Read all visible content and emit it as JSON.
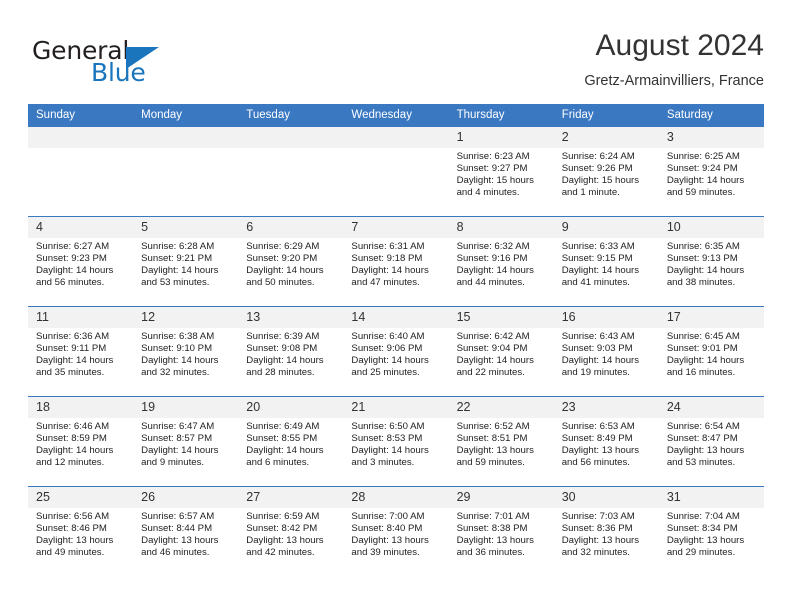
{
  "brand": {
    "name_part1": "General",
    "name_part2": "Blue",
    "accent_color": "#1b75bc"
  },
  "header": {
    "title": "August 2024",
    "subtitle": "Gretz-Armainvilliers, France"
  },
  "theme": {
    "header_row_color": "#3a78c2",
    "daynum_band_color": "#f2f2f2"
  },
  "labels": {
    "sunrise_prefix": "Sunrise:",
    "sunset_prefix": "Sunset:",
    "daylight_prefix": "Daylight:"
  },
  "weekdays": [
    "Sunday",
    "Monday",
    "Tuesday",
    "Wednesday",
    "Thursday",
    "Friday",
    "Saturday"
  ],
  "weeks": [
    [
      {
        "day": "",
        "empty": true
      },
      {
        "day": "",
        "empty": true
      },
      {
        "day": "",
        "empty": true
      },
      {
        "day": "",
        "empty": true
      },
      {
        "day": "1",
        "sunrise": "Sunrise: 6:23 AM",
        "sunset": "Sunset: 9:27 PM",
        "daylight_l1": "Daylight: 15 hours",
        "daylight_l2": "and 4 minutes."
      },
      {
        "day": "2",
        "sunrise": "Sunrise: 6:24 AM",
        "sunset": "Sunset: 9:26 PM",
        "daylight_l1": "Daylight: 15 hours",
        "daylight_l2": "and 1 minute."
      },
      {
        "day": "3",
        "sunrise": "Sunrise: 6:25 AM",
        "sunset": "Sunset: 9:24 PM",
        "daylight_l1": "Daylight: 14 hours",
        "daylight_l2": "and 59 minutes."
      }
    ],
    [
      {
        "day": "4",
        "sunrise": "Sunrise: 6:27 AM",
        "sunset": "Sunset: 9:23 PM",
        "daylight_l1": "Daylight: 14 hours",
        "daylight_l2": "and 56 minutes."
      },
      {
        "day": "5",
        "sunrise": "Sunrise: 6:28 AM",
        "sunset": "Sunset: 9:21 PM",
        "daylight_l1": "Daylight: 14 hours",
        "daylight_l2": "and 53 minutes."
      },
      {
        "day": "6",
        "sunrise": "Sunrise: 6:29 AM",
        "sunset": "Sunset: 9:20 PM",
        "daylight_l1": "Daylight: 14 hours",
        "daylight_l2": "and 50 minutes."
      },
      {
        "day": "7",
        "sunrise": "Sunrise: 6:31 AM",
        "sunset": "Sunset: 9:18 PM",
        "daylight_l1": "Daylight: 14 hours",
        "daylight_l2": "and 47 minutes."
      },
      {
        "day": "8",
        "sunrise": "Sunrise: 6:32 AM",
        "sunset": "Sunset: 9:16 PM",
        "daylight_l1": "Daylight: 14 hours",
        "daylight_l2": "and 44 minutes."
      },
      {
        "day": "9",
        "sunrise": "Sunrise: 6:33 AM",
        "sunset": "Sunset: 9:15 PM",
        "daylight_l1": "Daylight: 14 hours",
        "daylight_l2": "and 41 minutes."
      },
      {
        "day": "10",
        "sunrise": "Sunrise: 6:35 AM",
        "sunset": "Sunset: 9:13 PM",
        "daylight_l1": "Daylight: 14 hours",
        "daylight_l2": "and 38 minutes."
      }
    ],
    [
      {
        "day": "11",
        "sunrise": "Sunrise: 6:36 AM",
        "sunset": "Sunset: 9:11 PM",
        "daylight_l1": "Daylight: 14 hours",
        "daylight_l2": "and 35 minutes."
      },
      {
        "day": "12",
        "sunrise": "Sunrise: 6:38 AM",
        "sunset": "Sunset: 9:10 PM",
        "daylight_l1": "Daylight: 14 hours",
        "daylight_l2": "and 32 minutes."
      },
      {
        "day": "13",
        "sunrise": "Sunrise: 6:39 AM",
        "sunset": "Sunset: 9:08 PM",
        "daylight_l1": "Daylight: 14 hours",
        "daylight_l2": "and 28 minutes."
      },
      {
        "day": "14",
        "sunrise": "Sunrise: 6:40 AM",
        "sunset": "Sunset: 9:06 PM",
        "daylight_l1": "Daylight: 14 hours",
        "daylight_l2": "and 25 minutes."
      },
      {
        "day": "15",
        "sunrise": "Sunrise: 6:42 AM",
        "sunset": "Sunset: 9:04 PM",
        "daylight_l1": "Daylight: 14 hours",
        "daylight_l2": "and 22 minutes."
      },
      {
        "day": "16",
        "sunrise": "Sunrise: 6:43 AM",
        "sunset": "Sunset: 9:03 PM",
        "daylight_l1": "Daylight: 14 hours",
        "daylight_l2": "and 19 minutes."
      },
      {
        "day": "17",
        "sunrise": "Sunrise: 6:45 AM",
        "sunset": "Sunset: 9:01 PM",
        "daylight_l1": "Daylight: 14 hours",
        "daylight_l2": "and 16 minutes."
      }
    ],
    [
      {
        "day": "18",
        "sunrise": "Sunrise: 6:46 AM",
        "sunset": "Sunset: 8:59 PM",
        "daylight_l1": "Daylight: 14 hours",
        "daylight_l2": "and 12 minutes."
      },
      {
        "day": "19",
        "sunrise": "Sunrise: 6:47 AM",
        "sunset": "Sunset: 8:57 PM",
        "daylight_l1": "Daylight: 14 hours",
        "daylight_l2": "and 9 minutes."
      },
      {
        "day": "20",
        "sunrise": "Sunrise: 6:49 AM",
        "sunset": "Sunset: 8:55 PM",
        "daylight_l1": "Daylight: 14 hours",
        "daylight_l2": "and 6 minutes."
      },
      {
        "day": "21",
        "sunrise": "Sunrise: 6:50 AM",
        "sunset": "Sunset: 8:53 PM",
        "daylight_l1": "Daylight: 14 hours",
        "daylight_l2": "and 3 minutes."
      },
      {
        "day": "22",
        "sunrise": "Sunrise: 6:52 AM",
        "sunset": "Sunset: 8:51 PM",
        "daylight_l1": "Daylight: 13 hours",
        "daylight_l2": "and 59 minutes."
      },
      {
        "day": "23",
        "sunrise": "Sunrise: 6:53 AM",
        "sunset": "Sunset: 8:49 PM",
        "daylight_l1": "Daylight: 13 hours",
        "daylight_l2": "and 56 minutes."
      },
      {
        "day": "24",
        "sunrise": "Sunrise: 6:54 AM",
        "sunset": "Sunset: 8:47 PM",
        "daylight_l1": "Daylight: 13 hours",
        "daylight_l2": "and 53 minutes."
      }
    ],
    [
      {
        "day": "25",
        "sunrise": "Sunrise: 6:56 AM",
        "sunset": "Sunset: 8:46 PM",
        "daylight_l1": "Daylight: 13 hours",
        "daylight_l2": "and 49 minutes."
      },
      {
        "day": "26",
        "sunrise": "Sunrise: 6:57 AM",
        "sunset": "Sunset: 8:44 PM",
        "daylight_l1": "Daylight: 13 hours",
        "daylight_l2": "and 46 minutes."
      },
      {
        "day": "27",
        "sunrise": "Sunrise: 6:59 AM",
        "sunset": "Sunset: 8:42 PM",
        "daylight_l1": "Daylight: 13 hours",
        "daylight_l2": "and 42 minutes."
      },
      {
        "day": "28",
        "sunrise": "Sunrise: 7:00 AM",
        "sunset": "Sunset: 8:40 PM",
        "daylight_l1": "Daylight: 13 hours",
        "daylight_l2": "and 39 minutes."
      },
      {
        "day": "29",
        "sunrise": "Sunrise: 7:01 AM",
        "sunset": "Sunset: 8:38 PM",
        "daylight_l1": "Daylight: 13 hours",
        "daylight_l2": "and 36 minutes."
      },
      {
        "day": "30",
        "sunrise": "Sunrise: 7:03 AM",
        "sunset": "Sunset: 8:36 PM",
        "daylight_l1": "Daylight: 13 hours",
        "daylight_l2": "and 32 minutes."
      },
      {
        "day": "31",
        "sunrise": "Sunrise: 7:04 AM",
        "sunset": "Sunset: 8:34 PM",
        "daylight_l1": "Daylight: 13 hours",
        "daylight_l2": "and 29 minutes."
      }
    ]
  ]
}
